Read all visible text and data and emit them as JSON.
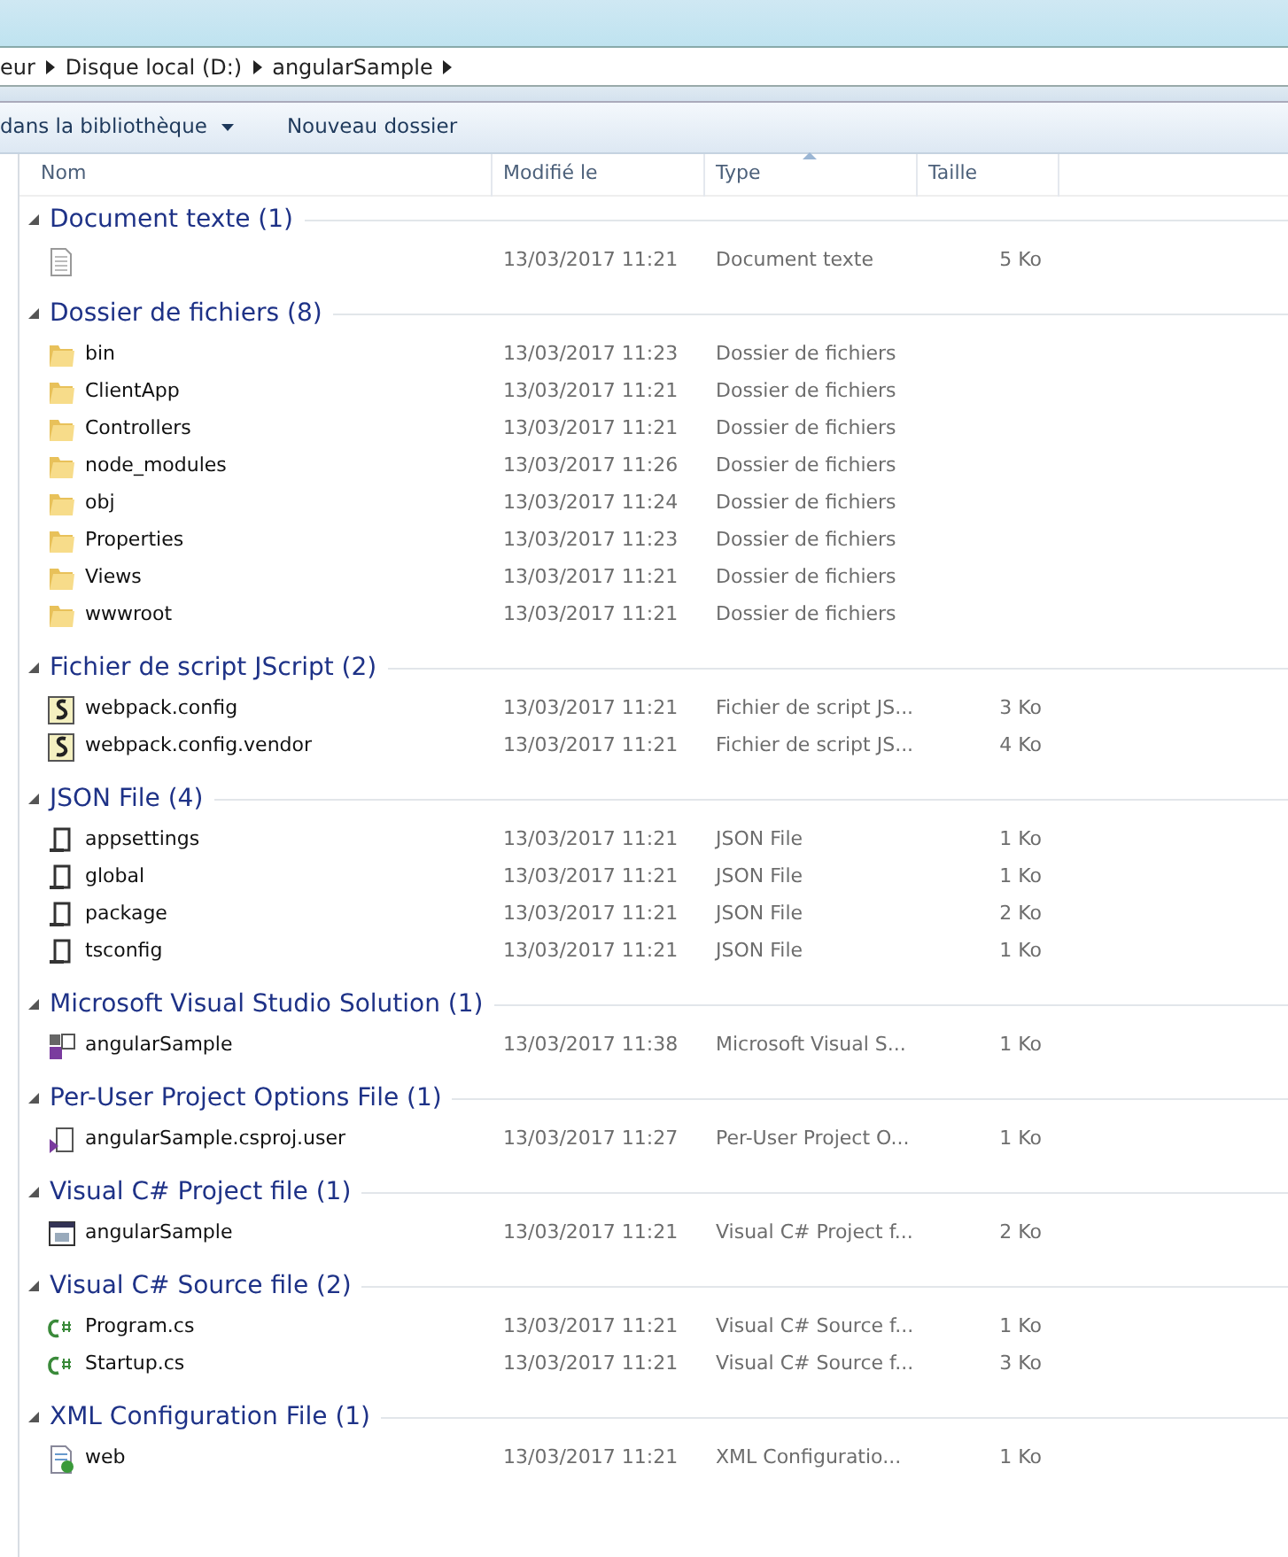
{
  "breadcrumb": [
    {
      "label": "eur"
    },
    {
      "label": "Disque local (D:)"
    },
    {
      "label": "angularSample"
    }
  ],
  "toolbar": {
    "buttons": [
      {
        "label": "dans la bibliothèque",
        "dropdown": true
      },
      {
        "label": "Nouveau dossier",
        "dropdown": false
      }
    ]
  },
  "columns": [
    {
      "label": "Nom",
      "sorted": false
    },
    {
      "label": "Modifié le",
      "sorted": false
    },
    {
      "label": "Type",
      "sorted": true
    },
    {
      "label": "Taille",
      "sorted": false
    }
  ],
  "groups": [
    {
      "title": "Document texte (1)",
      "expanded": true,
      "files": [
        {
          "kind": "text",
          "modified": "13/03/2017 11:21",
          "type": "Document texte",
          "size": "5 Ko"
        }
      ]
    },
    {
      "title": "Dossier de fichiers (8)",
      "expanded": true,
      "files": [
        {
          "kind": "folder",
          "name": "bin",
          "modified": "13/03/2017 11:23",
          "type": "Dossier de fichiers"
        },
        {
          "kind": "folder",
          "name": "ClientApp",
          "modified": "13/03/2017 11:21",
          "type": "Dossier de fichiers"
        },
        {
          "kind": "folder",
          "name": "Controllers",
          "modified": "13/03/2017 11:21",
          "type": "Dossier de fichiers"
        },
        {
          "kind": "folder",
          "name": "node_modules",
          "modified": "13/03/2017 11:26",
          "type": "Dossier de fichiers"
        },
        {
          "kind": "folder",
          "name": "obj",
          "modified": "13/03/2017 11:24",
          "type": "Dossier de fichiers"
        },
        {
          "kind": "folder",
          "name": "Properties",
          "modified": "13/03/2017 11:23",
          "type": "Dossier de fichiers"
        },
        {
          "kind": "folder",
          "name": "Views",
          "modified": "13/03/2017 11:21",
          "type": "Dossier de fichiers"
        },
        {
          "kind": "folder",
          "name": "wwwroot",
          "modified": "13/03/2017 11:21",
          "type": "Dossier de fichiers"
        }
      ]
    },
    {
      "title": "Fichier de script JScript (2)",
      "expanded": true,
      "files": [
        {
          "kind": "script",
          "name": "webpack.config",
          "modified": "13/03/2017 11:21",
          "type": "Fichier de script JS...",
          "size": "3 Ko"
        },
        {
          "kind": "script",
          "name": "webpack.config.vendor",
          "modified": "13/03/2017 11:21",
          "type": "Fichier de script JS...",
          "size": "4 Ko"
        }
      ]
    },
    {
      "title": "JSON File (4)",
      "expanded": true,
      "files": [
        {
          "kind": "json",
          "name": "appsettings",
          "modified": "13/03/2017 11:21",
          "type": "JSON File",
          "size": "1 Ko"
        },
        {
          "kind": "json",
          "name": "global",
          "modified": "13/03/2017 11:21",
          "type": "JSON File",
          "size": "1 Ko"
        },
        {
          "kind": "json",
          "name": "package",
          "modified": "13/03/2017 11:21",
          "type": "JSON File",
          "size": "2 Ko"
        },
        {
          "kind": "json",
          "name": "tsconfig",
          "modified": "13/03/2017 11:21",
          "type": "JSON File",
          "size": "1 Ko"
        }
      ]
    },
    {
      "title": "Microsoft Visual Studio Solution (1)",
      "expanded": true,
      "files": [
        {
          "kind": "solution",
          "name": "angularSample",
          "modified": "13/03/2017 11:38",
          "type": "Microsoft Visual S...",
          "size": "1 Ko"
        }
      ]
    },
    {
      "title": "Per-User Project Options File (1)",
      "expanded": true,
      "files": [
        {
          "kind": "user",
          "name": "angularSample.csproj.user",
          "modified": "13/03/2017 11:27",
          "type": "Per-User Project O...",
          "size": "1 Ko"
        }
      ]
    },
    {
      "title": "Visual C# Project file (1)",
      "expanded": true,
      "files": [
        {
          "kind": "project",
          "name": "angularSample",
          "modified": "13/03/2017 11:21",
          "type": "Visual C# Project f...",
          "size": "2 Ko"
        }
      ]
    },
    {
      "title": "Visual C# Source file (2)",
      "expanded": true,
      "files": [
        {
          "kind": "csharp",
          "name": "Program.cs",
          "modified": "13/03/2017 11:21",
          "type": "Visual C# Source f...",
          "size": "1 Ko"
        },
        {
          "kind": "csharp",
          "name": "Startup.cs",
          "modified": "13/03/2017 11:21",
          "type": "Visual C# Source f...",
          "size": "3 Ko"
        }
      ]
    },
    {
      "title": "XML Configuration File (1)",
      "expanded": true,
      "files": [
        {
          "kind": "xml",
          "name": "web",
          "modified": "13/03/2017 11:21",
          "type": "XML Configuratio...",
          "size": "1 Ko"
        }
      ]
    }
  ]
}
